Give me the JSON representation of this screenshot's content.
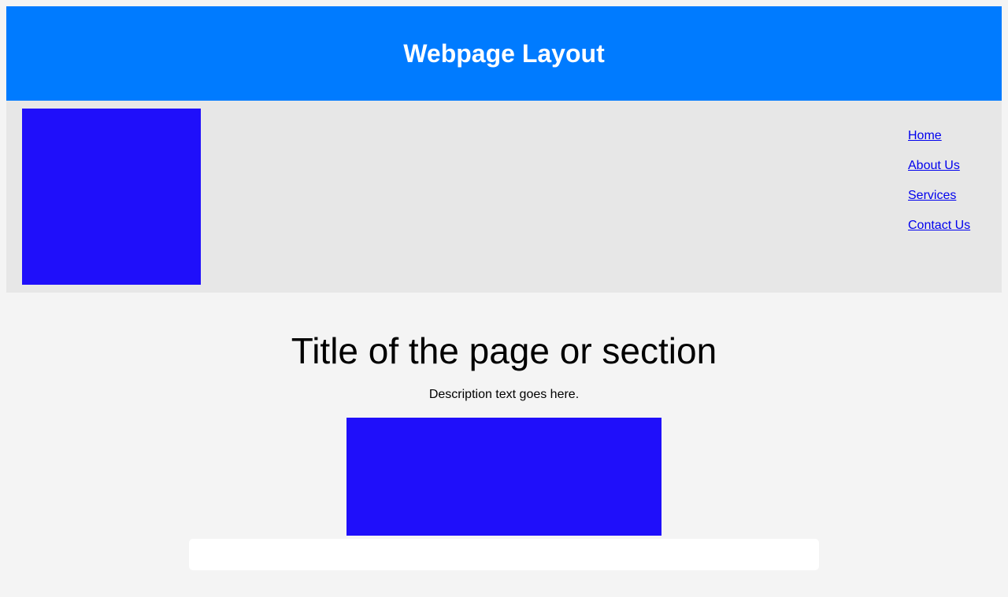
{
  "header": {
    "title": "Webpage Layout"
  },
  "nav": {
    "items": [
      {
        "label": "Home"
      },
      {
        "label": "About Us"
      },
      {
        "label": "Services"
      },
      {
        "label": "Contact Us"
      }
    ]
  },
  "main": {
    "title": "Title of the page or section",
    "description": "Description text goes here."
  },
  "colors": {
    "header_bg": "#007bff",
    "topbar_bg": "#e7e7e7",
    "block_blue": "#1f0ffa",
    "page_bg": "#f4f4f4",
    "link": "#0000ee"
  }
}
